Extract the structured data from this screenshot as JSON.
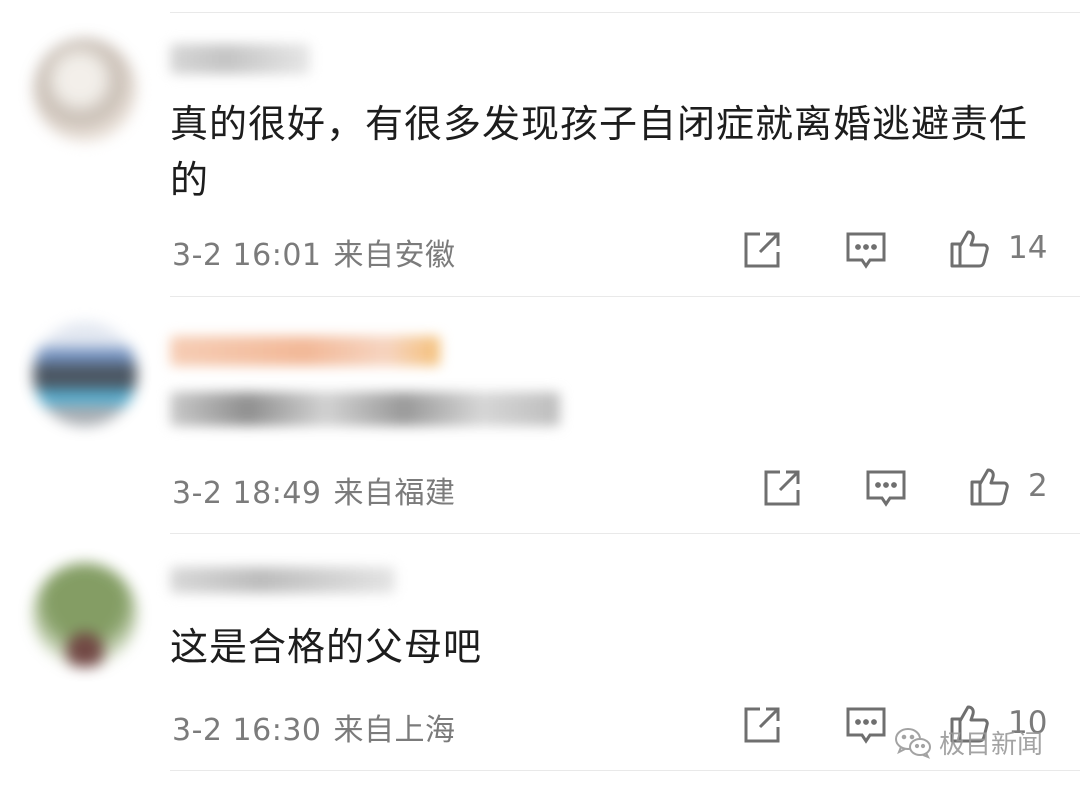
{
  "comments": [
    {
      "text": "真的很好，有很多发现孩子自闭症就离婚逃避责任的",
      "time": "3-2 16:01",
      "location": "来自安徽",
      "likes": "14",
      "avatar_colors": [
        "#e9dfd6",
        "#bdb1a6",
        "#f1ede7"
      ]
    },
    {
      "text": "",
      "time": "3-2 18:49",
      "location": "来自福建",
      "likes": "2",
      "avatar_colors": [
        "#5b7fb6",
        "#2d3a48",
        "#3aa0c8"
      ]
    },
    {
      "text": "这是合格的父母吧",
      "time": "3-2 16:30",
      "location": "来自上海",
      "likes": "10",
      "avatar_colors": [
        "#6f8d4a",
        "#5a2a25",
        "#dfe6d4"
      ]
    }
  ],
  "icons": {
    "share": "share-icon",
    "reply": "comment-icon",
    "like": "thumbs-up-icon"
  },
  "colors": {
    "meta_text": "#7b7b7b",
    "icon_stroke": "#6f6f6f",
    "separator": "#e9e9e9"
  },
  "watermark": {
    "text": "极目新闻",
    "icon": "wechat-icon"
  }
}
